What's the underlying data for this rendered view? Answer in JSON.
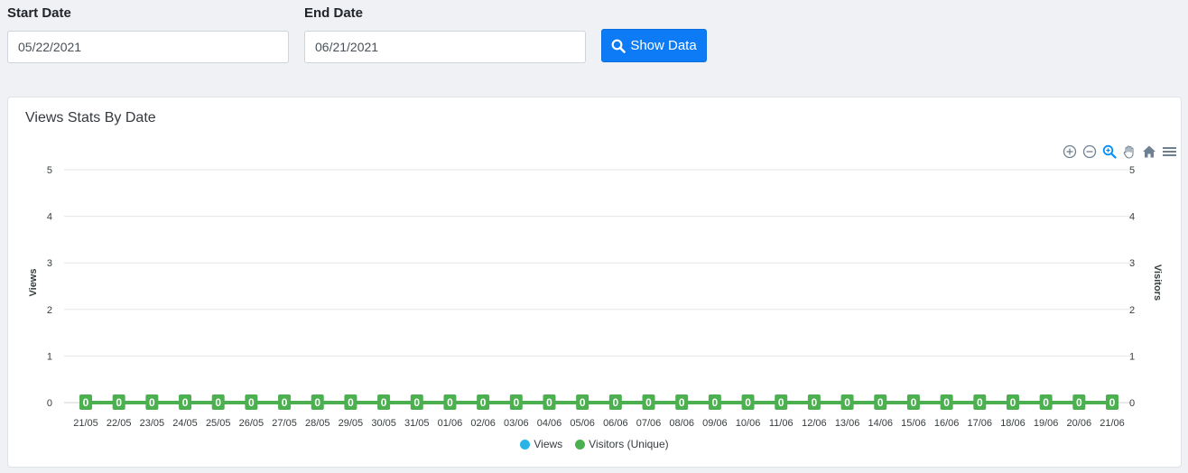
{
  "filters": {
    "start_label": "Start Date",
    "start_value": "05/22/2021",
    "end_label": "End Date",
    "end_value": "06/21/2021",
    "show_button": "Show Data"
  },
  "card": {
    "title": "Views Stats By Date"
  },
  "toolbar": {
    "icons": [
      "zoom-in-icon",
      "zoom-out-icon",
      "zoom-select-icon",
      "pan-hand-icon",
      "reset-home-icon",
      "menu-icon"
    ]
  },
  "colors": {
    "primary": "#0d7bf5",
    "views": "#2ab4e6",
    "visitors": "#4caf50",
    "grid": "#e6e6e6"
  },
  "chart_data": {
    "type": "line",
    "categories": [
      "21/05",
      "22/05",
      "23/05",
      "24/05",
      "25/05",
      "26/05",
      "27/05",
      "28/05",
      "29/05",
      "30/05",
      "31/05",
      "01/06",
      "02/06",
      "03/06",
      "04/06",
      "05/06",
      "06/06",
      "07/06",
      "08/06",
      "09/06",
      "10/06",
      "11/06",
      "12/06",
      "13/06",
      "14/06",
      "15/06",
      "16/06",
      "17/06",
      "18/06",
      "19/06",
      "20/06",
      "21/06"
    ],
    "series": [
      {
        "name": "Views",
        "values": [
          0,
          0,
          0,
          0,
          0,
          0,
          0,
          0,
          0,
          0,
          0,
          0,
          0,
          0,
          0,
          0,
          0,
          0,
          0,
          0,
          0,
          0,
          0,
          0,
          0,
          0,
          0,
          0,
          0,
          0,
          0,
          0
        ]
      },
      {
        "name": "Visitors (Unique)",
        "values": [
          0,
          0,
          0,
          0,
          0,
          0,
          0,
          0,
          0,
          0,
          0,
          0,
          0,
          0,
          0,
          0,
          0,
          0,
          0,
          0,
          0,
          0,
          0,
          0,
          0,
          0,
          0,
          0,
          0,
          0,
          0,
          0
        ]
      }
    ],
    "ylabel": "Views",
    "ylabel_right": "Visitors",
    "ylim": [
      0,
      5
    ],
    "yticks": [
      0,
      1,
      2,
      3,
      4,
      5
    ],
    "grid": true,
    "legend_position": "bottom",
    "data_labels": true
  }
}
